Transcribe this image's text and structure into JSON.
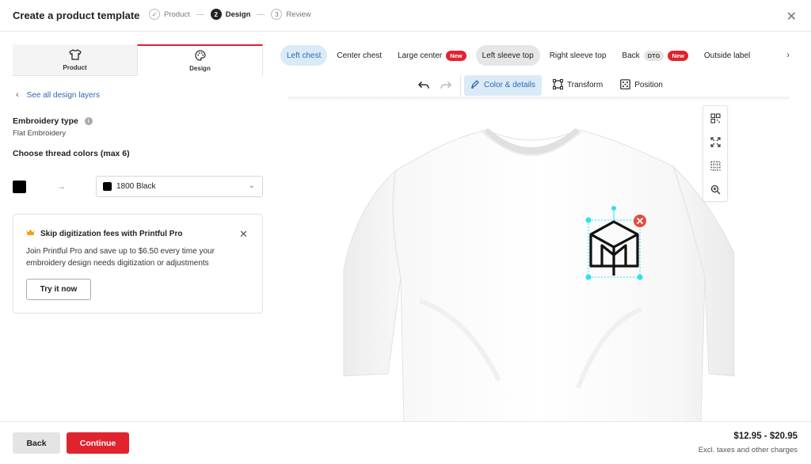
{
  "header": {
    "title": "Create a product template",
    "steps": [
      {
        "num": "✓",
        "label": "Product"
      },
      {
        "num": "2",
        "label": "Design"
      },
      {
        "num": "3",
        "label": "Review"
      }
    ],
    "close_icon": "close-icon"
  },
  "panel_tabs": [
    {
      "label": "Product",
      "icon": "tshirt-icon"
    },
    {
      "label": "Design",
      "icon": "palette-icon"
    }
  ],
  "left": {
    "back_link": "See all design layers",
    "embroidery_type_label": "Embroidery type",
    "embroidery_type_value": "Flat Embroidery",
    "thread_colors_label": "Choose thread colors (max 6)",
    "thread": {
      "current_color": "#000000",
      "selected": "1800 Black"
    }
  },
  "promo": {
    "title": "Skip digitization fees with Printful Pro",
    "body": "Join Printful Pro and save up to $6.50 every time your embroidery design needs digitization or adjustments",
    "cta": "Try it now"
  },
  "placements": [
    {
      "label": "Left chest",
      "state": "selected"
    },
    {
      "label": "Center chest"
    },
    {
      "label": "Large center",
      "badge": "New"
    },
    {
      "label": "Left sleeve top",
      "state": "hover"
    },
    {
      "label": "Right sleeve top"
    },
    {
      "label": "Back",
      "badge2": "DTG",
      "badge": "New"
    },
    {
      "label": "Outside label"
    }
  ],
  "toolbar": {
    "undo_icon": "undo-icon",
    "redo_icon": "redo-icon",
    "color_details": "Color & details",
    "transform": "Transform",
    "position": "Position"
  },
  "side_tools": [
    "qr-layout-icon",
    "expand-icon",
    "grid-icon",
    "zoom-icon"
  ],
  "footer": {
    "back": "Back",
    "continue": "Continue",
    "price": "$12.95 - $20.95",
    "price_note": "Excl. taxes and other charges"
  },
  "colors": {
    "accent_red": "#e0232f",
    "link_blue": "#2a6bb5",
    "selection_cyan": "#2ee0ee"
  }
}
